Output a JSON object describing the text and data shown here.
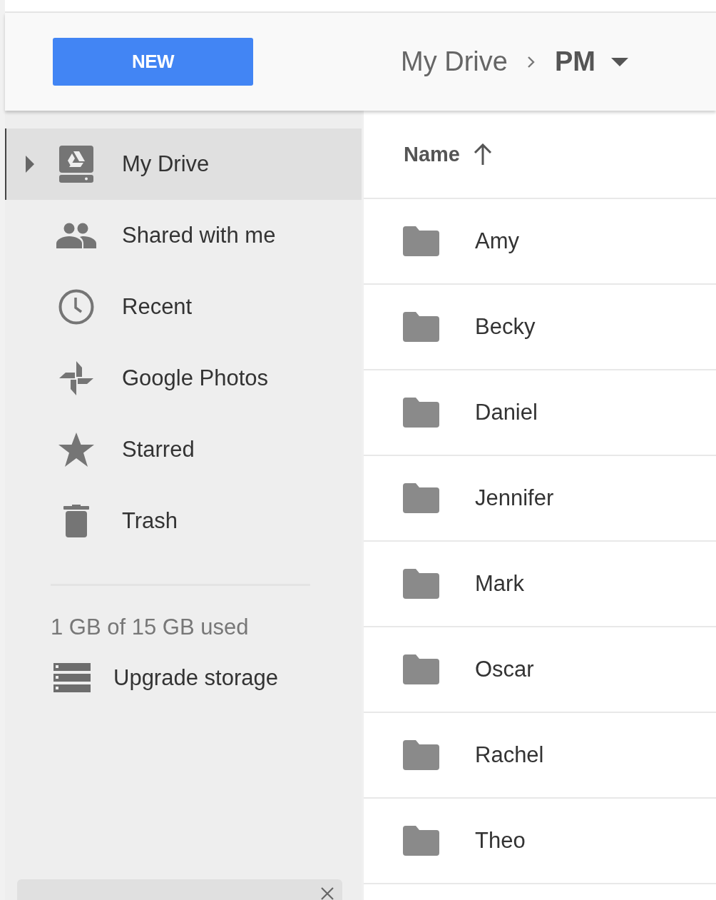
{
  "header": {
    "new_button": "NEW",
    "breadcrumb": [
      {
        "label": "My Drive",
        "current": false
      },
      {
        "label": "PM",
        "current": true
      }
    ]
  },
  "sidebar": {
    "items": [
      {
        "kind": "drive",
        "label": "My Drive",
        "selected": true,
        "expandable": true
      },
      {
        "kind": "shared",
        "label": "Shared with me",
        "selected": false,
        "expandable": false
      },
      {
        "kind": "recent",
        "label": "Recent",
        "selected": false,
        "expandable": false
      },
      {
        "kind": "photos",
        "label": "Google Photos",
        "selected": false,
        "expandable": false
      },
      {
        "kind": "starred",
        "label": "Starred",
        "selected": false,
        "expandable": false
      },
      {
        "kind": "trash",
        "label": "Trash",
        "selected": false,
        "expandable": false
      }
    ],
    "storage_usage": "1 GB of 15 GB used",
    "upgrade": "Upgrade storage"
  },
  "file_list": {
    "column": "Name",
    "sorted_ascending": true,
    "rows": [
      "Amy",
      "Becky",
      "Daniel",
      "Jennifer",
      "Mark",
      "Oscar",
      "Rachel",
      "Theo"
    ]
  }
}
